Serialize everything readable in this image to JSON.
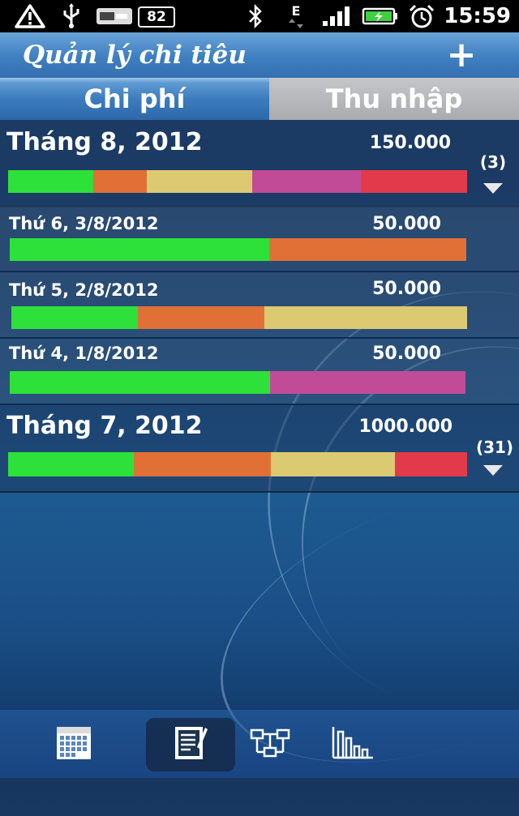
{
  "status_bar": {
    "icons": [
      "warning-icon",
      "usb-icon",
      "debug-icon",
      "bluetooth-icon",
      "edge-signal-icon",
      "signal-icon",
      "battery-icon",
      "alarm-icon"
    ],
    "battery_level": "82",
    "network_type": "E",
    "time": "15:59"
  },
  "app_bar": {
    "title": "Quản lý chi tiêu",
    "add_label": "+"
  },
  "tabs": [
    {
      "label": "Chi phí",
      "active": true
    },
    {
      "label": "Thu nhập",
      "active": false
    }
  ],
  "colors": {
    "green": "#2ee03a",
    "orange": "#e07036",
    "yellow": "#dcca72",
    "pink": "#c24b98",
    "red": "#e23a4a"
  },
  "entries": [
    {
      "type": "month",
      "label": "Tháng 8, 2012",
      "amount": "150.000",
      "count": "(3)",
      "segments": [
        {
          "color": "#2ee03a",
          "share": 0.185
        },
        {
          "color": "#e07036",
          "share": 0.117
        },
        {
          "color": "#dcca72",
          "share": 0.23
        },
        {
          "color": "#c24b98",
          "share": 0.237
        },
        {
          "color": "#e23a4a",
          "share": 0.231
        }
      ]
    },
    {
      "type": "day",
      "label": "Thứ 6, 3/8/2012",
      "amount": "50.000",
      "segments": [
        {
          "color": "#2ee03a",
          "share": 0.568
        },
        {
          "color": "#e07036",
          "share": 0.432
        }
      ]
    },
    {
      "type": "day",
      "label": "Thứ 5, 2/8/2012",
      "amount": "50.000",
      "segments": [
        {
          "color": "#2ee03a",
          "share": 0.278
        },
        {
          "color": "#e07036",
          "share": 0.278
        },
        {
          "color": "#dcca72",
          "share": 0.444
        }
      ]
    },
    {
      "type": "day",
      "label": "Thứ 4, 1/8/2012",
      "amount": "50.000",
      "segments": [
        {
          "color": "#2ee03a",
          "share": 0.571
        },
        {
          "color": "#c24b98",
          "share": 0.429
        }
      ]
    },
    {
      "type": "month",
      "label": "Tháng 7, 2012",
      "amount": "1000.000",
      "count": "(31)",
      "segments": [
        {
          "color": "#2ee03a",
          "share": 0.274
        },
        {
          "color": "#e07036",
          "share": 0.299
        },
        {
          "color": "#dcca72",
          "share": 0.269
        },
        {
          "color": "#e23a4a",
          "share": 0.158
        }
      ]
    }
  ],
  "bottom_nav": {
    "items": [
      {
        "icon": "calendar-icon",
        "active": false
      },
      {
        "icon": "notepad-icon",
        "active": true
      },
      {
        "icon": "transfer-icon",
        "active": false
      },
      {
        "icon": "bar-chart-icon",
        "active": false
      }
    ]
  }
}
